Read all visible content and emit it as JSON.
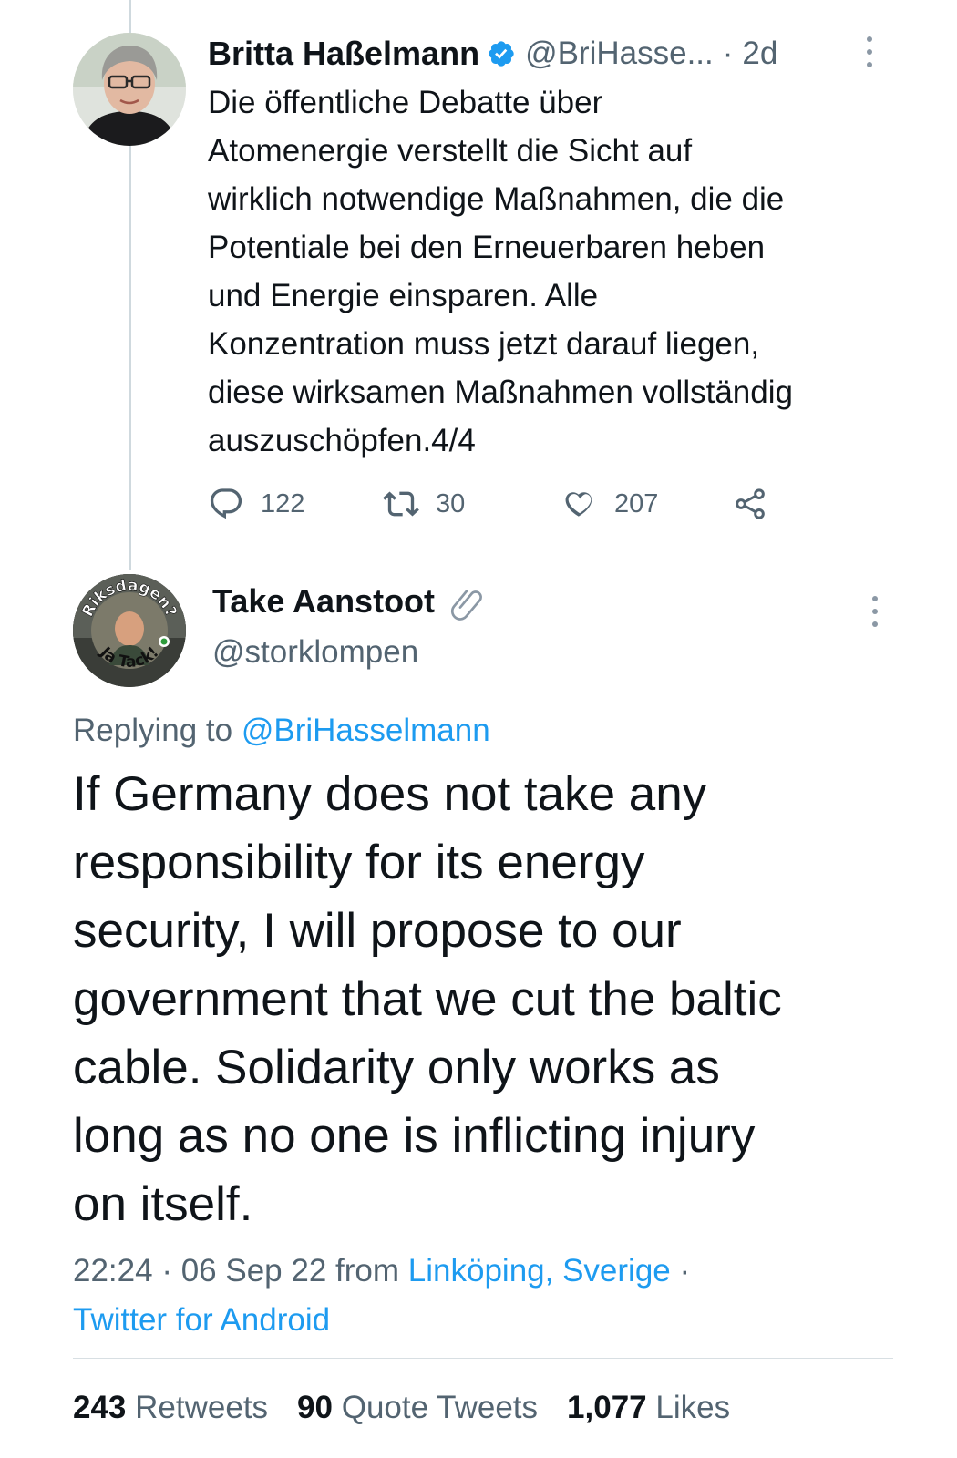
{
  "parent_tweet": {
    "author_name": "Britta Haßelmann",
    "handle": "@BriHasse...",
    "separator": "·",
    "time": "2d",
    "text_lines": [
      "Die öffentliche Debatte über",
      "Atomenergie verstellt die Sicht auf",
      "wirklich notwendige Maßnahmen, die die",
      "Potentiale bei den Erneuerbaren heben",
      "und Energie einsparen. Alle",
      "Konzentration muss jetzt darauf liegen,",
      "diese wirksamen Maßnahmen vollständig",
      "auszuschöpfen.4/4"
    ],
    "replies": "122",
    "retweets": "30",
    "likes": "207",
    "icons": [
      "verified-badge-icon",
      "more-icon",
      "reply-icon",
      "retweet-icon",
      "like-icon",
      "share-icon"
    ]
  },
  "main_tweet": {
    "author_name": "Take Aanstoot",
    "handle": "@storklompen",
    "replying_prefix": "Replying to",
    "replying_to": "@BriHasselmann",
    "text_lines": [
      "If Germany does not take any",
      "responsibility for its energy",
      "security, I will propose to our",
      "government that we cut the baltic",
      "cable. Solidarity only works as",
      "long as no one is inflicting injury",
      "on itself."
    ],
    "time": "22:24",
    "date": "06 Sep 22",
    "from_label": "from",
    "location": "Linköping, Sverige",
    "separator": "·",
    "source": "Twitter for Android",
    "avatar_text_top": "Riksdagen?",
    "avatar_text_bottom": "Ja Tack!",
    "icons": [
      "paperclip-icon",
      "more-icon"
    ]
  },
  "stats": {
    "retweets_count": "243",
    "retweets_label": "Retweets",
    "quotes_count": "90",
    "quotes_label": "Quote Tweets",
    "likes_count": "1,077",
    "likes_label": "Likes"
  },
  "colors": {
    "text": "#0f1419",
    "secondary": "#536471",
    "link": "#1d9bf0",
    "verified": "#1d9bf0",
    "thread_line": "#cfd9de"
  }
}
